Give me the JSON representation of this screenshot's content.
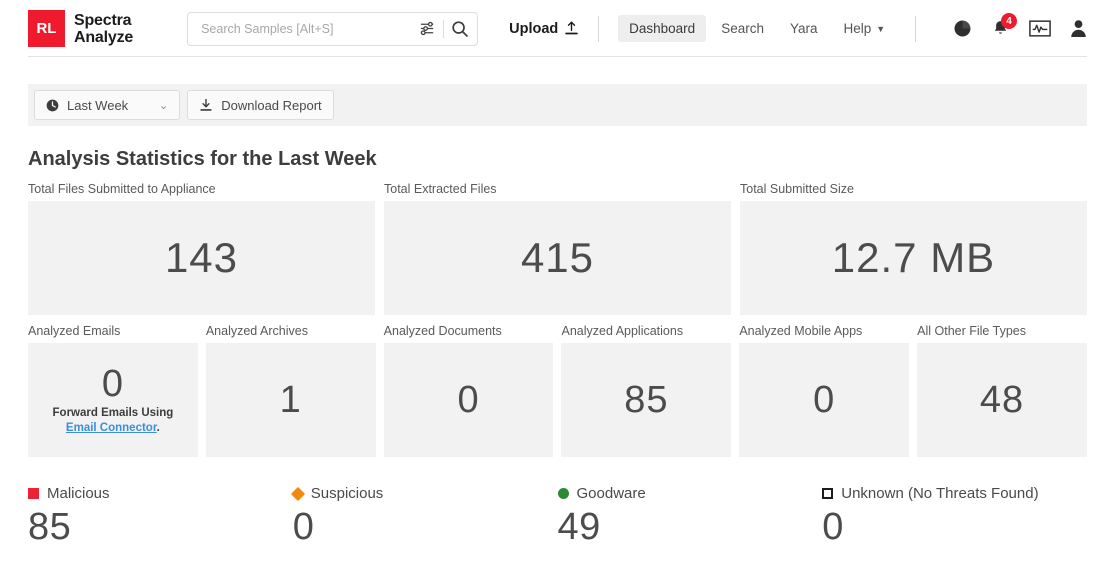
{
  "header": {
    "logo": {
      "mark_left": "Я",
      "mark_right": "L",
      "line1": "Spectra",
      "line2": "Analyze"
    },
    "search": {
      "placeholder": "Search Samples [Alt+S]",
      "value": ""
    },
    "upload_label": "Upload",
    "nav": [
      {
        "label": "Dashboard",
        "active": true
      },
      {
        "label": "Search",
        "active": false
      },
      {
        "label": "Yara",
        "active": false
      },
      {
        "label": "Help",
        "active": false,
        "has_caret": true
      }
    ],
    "notification_count": "4"
  },
  "toolbar": {
    "date_filter": "Last Week",
    "download_label": "Download Report"
  },
  "main": {
    "title": "Analysis Statistics for the Last Week",
    "row1": [
      {
        "label": "Total Files Submitted to Appliance",
        "value": "143"
      },
      {
        "label": "Total Extracted Files",
        "value": "415"
      },
      {
        "label": "Total Submitted Size",
        "value": "12.7 MB"
      }
    ],
    "row2": [
      {
        "label": "Analyzed Emails",
        "value": "0",
        "note_prefix": "Forward Emails Using",
        "note_link": "Email Connector",
        "note_suffix": "."
      },
      {
        "label": "Analyzed Archives",
        "value": "1"
      },
      {
        "label": "Analyzed Documents",
        "value": "0"
      },
      {
        "label": "Analyzed Applications",
        "value": "85"
      },
      {
        "label": "Analyzed Mobile Apps",
        "value": "0"
      },
      {
        "label": "All Other File Types",
        "value": "48"
      }
    ],
    "classifications": [
      {
        "label": "Malicious",
        "value": "85",
        "color": "#ee2233",
        "marker": "square"
      },
      {
        "label": "Suspicious",
        "value": "0",
        "color": "#f18a0a",
        "marker": "diamond"
      },
      {
        "label": "Goodware",
        "value": "49",
        "color": "#2d8a32",
        "marker": "circle"
      },
      {
        "label": "Unknown (No Threats Found)",
        "value": "0",
        "color": "#1c1c1c",
        "marker": "hollow-square"
      }
    ]
  }
}
